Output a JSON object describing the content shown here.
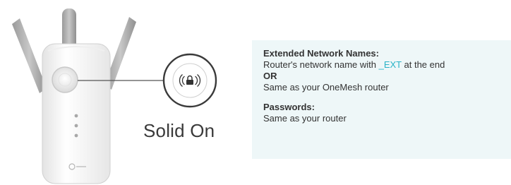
{
  "status": {
    "led_state": "Solid On"
  },
  "info": {
    "network_heading": "Extended Network Names:",
    "network_line1_before": "Router's network name with ",
    "network_line1_ext": "_EXT",
    "network_line1_after": " at the end",
    "or_label": "OR",
    "network_line2": "Same as your OneMesh router",
    "passwords_heading": "Passwords:",
    "passwords_line": "Same as your router"
  },
  "colors": {
    "info_background": "#eef7f8",
    "ext_highlight": "#2ab3c7"
  },
  "icons": {
    "led_icon": "wifi-lock-icon",
    "brand_logo": "tp-link-logo"
  }
}
